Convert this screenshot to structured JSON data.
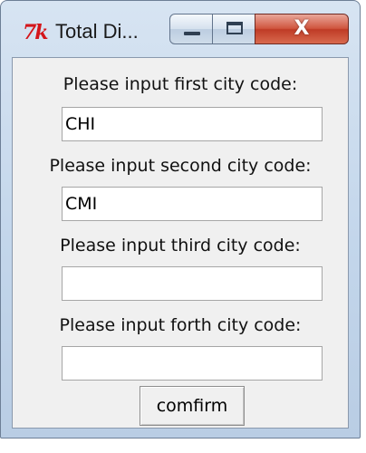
{
  "window": {
    "title": "Total Di...",
    "icon_text": "7k",
    "close_glyph": "X"
  },
  "form": {
    "first_label": "Please input first city code:",
    "first_value": "CHI",
    "second_label": "Please input second city code:",
    "second_value": "CMI",
    "third_label": "Please input third city code:",
    "third_value": "",
    "forth_label": "Please input forth city code:",
    "forth_value": "",
    "confirm_label": "comfirm"
  },
  "colors": {
    "close_button": "#c8472f",
    "tk_icon": "#d4161b",
    "client_bg": "#f0f0f0"
  }
}
